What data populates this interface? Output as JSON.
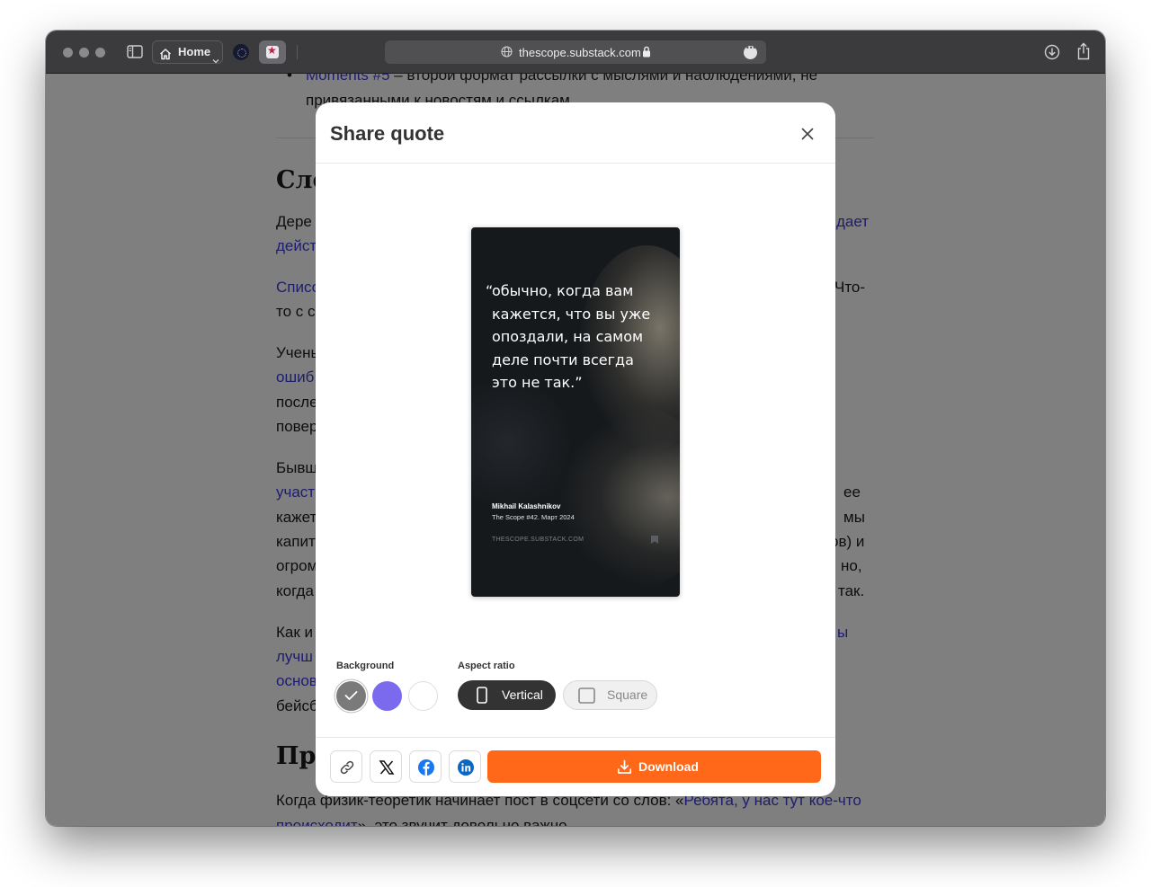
{
  "browser": {
    "home_label": "Home",
    "url_host": "thescope.substack.com"
  },
  "article": {
    "bullet_link": "Moments #5",
    "bullet_text": " – второй формат рассылки с мыслями и наблюдениями, не привязанными к новостям и ссылкам",
    "heading_1": "Сло",
    "p1_text": "Дере",
    "p1_link_right": "дает",
    "p1_link_left": "дейст",
    "p2_link": "Списо",
    "p2_right": "Что-",
    "p2_line2": "то с с",
    "p3_l1": "Учены",
    "p3_l2": "ошиб",
    "p3_l3": "после",
    "p3_l4": "повер",
    "p4_l1": "Бывш",
    "p4_l2": "участ",
    "p4_r2": "ее",
    "p4_l3": "кажет",
    "p4_r3": "мы",
    "p4_l4": "капит",
    "p4_r4": "ов) и",
    "p4_l5": "огром",
    "p4_r5": "но,",
    "p4_l6": "когда",
    "p4_r6": "так.",
    "p5_l1": "Как и",
    "p5_r1": "ы",
    "p5_l2": "лучш",
    "p5_l3": "основ",
    "p5_l4": "бейсб",
    "heading_2": "Пр",
    "p6_text": "Когда физик-теоретик начинает пост в соцсети со слов: «",
    "p6_link": "Ребята, у нас тут кое-что происходит",
    "p6_tail": "», это звучит довольно важно"
  },
  "modal": {
    "title": "Share quote",
    "quote_open": "“",
    "quote_text": "обычно, когда вам кажется, что вы уже опоздали, на самом деле почти всегда это не так.”",
    "author": "Mikhail Kalashnikov",
    "source": "The Scope #42. Март 2024",
    "site": "THESCOPE.SUBSTACK.COM",
    "background_label": "Background",
    "aspect_label": "Aspect ratio",
    "swatches": [
      "#7a7a7a",
      "#7b69ee",
      "#ffffff"
    ],
    "selected_swatch": 0,
    "ratio_vertical": "Vertical",
    "ratio_square": "Square",
    "selected_ratio": "Vertical",
    "download_label": "Download"
  },
  "colors": {
    "accent": "#ff6719",
    "link": "#3d3bd6",
    "dark_button": "#333333"
  },
  "icons": [
    "sidebar-icon",
    "house-icon",
    "chevron-down-icon",
    "globe-icon",
    "lock-icon",
    "more-icon",
    "download-circle-icon",
    "share-icon",
    "close-icon",
    "check-icon",
    "phone-icon",
    "square-icon",
    "link-icon",
    "x-icon",
    "facebook-icon",
    "linkedin-icon",
    "download-icon"
  ]
}
